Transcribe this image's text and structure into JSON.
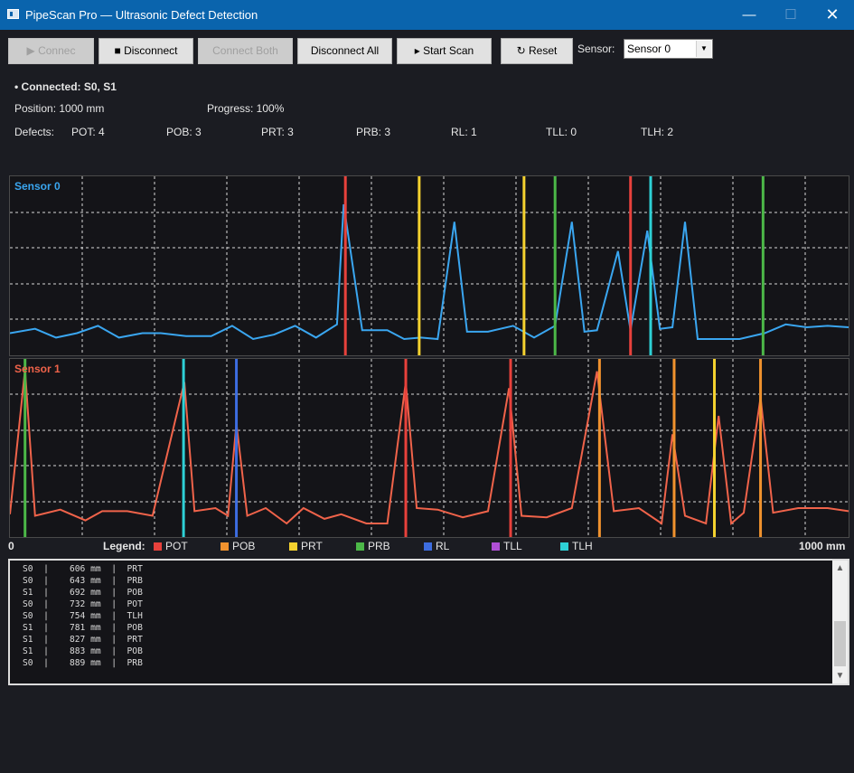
{
  "window": {
    "title": "PipeScan Pro — Ultrasonic Defect Detection",
    "min_glyph": "—",
    "max_glyph": "☐",
    "close_glyph": "✕"
  },
  "toolbar": {
    "connect_label": "▶ Connec",
    "disconnect_label": "■ Disconnect",
    "connect_both_label": "Connect Both",
    "disconnect_all_label": "Disconnect All",
    "start_scan_label": "▸ Start Scan",
    "reset_label": "↻ Reset",
    "sensor_label": "Sensor:",
    "sensor_selected": "Sensor 0",
    "sensor_arrow": "▼"
  },
  "status": {
    "connected": "• Connected: S0, S1",
    "position": "Position: 1000 mm",
    "progress": "Progress: 100%"
  },
  "defects": {
    "label": "Defects:",
    "items": [
      "POT: 4",
      "POB: 3",
      "PRT: 3",
      "PRB: 3",
      "RL: 1",
      "TLL: 0",
      "TLH: 2"
    ]
  },
  "colors": {
    "POT": "#e8413c",
    "POB": "#f0922e",
    "PRT": "#f5d22f",
    "PRB": "#4cb848",
    "RL": "#3d6de0",
    "TLL": "#b04fd6",
    "TLH": "#2ed1d6",
    "sensor0": "#3aa6f0",
    "sensor1": "#f0634a"
  },
  "sensor0": {
    "label": "Sensor 0",
    "trace": [
      [
        0,
        0.04
      ],
      [
        30,
        0.07
      ],
      [
        55,
        0.01
      ],
      [
        80,
        0.04
      ],
      [
        105,
        0.09
      ],
      [
        130,
        0.01
      ],
      [
        158,
        0.04
      ],
      [
        180,
        0.04
      ],
      [
        210,
        0.02
      ],
      [
        240,
        0.02
      ],
      [
        265,
        0.09
      ],
      [
        290,
        0.0
      ],
      [
        315,
        0.03
      ],
      [
        340,
        0.09
      ],
      [
        365,
        0.01
      ],
      [
        390,
        0.1
      ],
      [
        398,
        0.92
      ],
      [
        420,
        0.06
      ],
      [
        450,
        0.06
      ],
      [
        470,
        0.0
      ],
      [
        490,
        0.01
      ],
      [
        510,
        0.0
      ],
      [
        530,
        0.8
      ],
      [
        545,
        0.05
      ],
      [
        570,
        0.05
      ],
      [
        600,
        0.09
      ],
      [
        625,
        0.01
      ],
      [
        650,
        0.09
      ],
      [
        670,
        0.8
      ],
      [
        685,
        0.05
      ],
      [
        700,
        0.06
      ],
      [
        725,
        0.6
      ],
      [
        740,
        0.06
      ],
      [
        760,
        0.74
      ],
      [
        775,
        0.07
      ],
      [
        790,
        0.08
      ],
      [
        805,
        0.8
      ],
      [
        820,
        0.0
      ],
      [
        840,
        0.0
      ],
      [
        870,
        0.0
      ],
      [
        900,
        0.04
      ],
      [
        925,
        0.1
      ],
      [
        950,
        0.08
      ],
      [
        975,
        0.09
      ],
      [
        1000,
        0.08
      ]
    ],
    "markers": [
      [
        400,
        "POT"
      ],
      [
        488,
        "PRT"
      ],
      [
        613,
        "PRT"
      ],
      [
        650,
        "PRB"
      ],
      [
        740,
        "POT"
      ],
      [
        764,
        "TLH"
      ],
      [
        898,
        "PRB"
      ]
    ]
  },
  "sensor1": {
    "label": "Sensor 1",
    "trace": [
      [
        0,
        0.06
      ],
      [
        18,
        1.0
      ],
      [
        30,
        0.05
      ],
      [
        60,
        0.09
      ],
      [
        90,
        0.02
      ],
      [
        110,
        0.08
      ],
      [
        140,
        0.08
      ],
      [
        170,
        0.05
      ],
      [
        208,
        0.92
      ],
      [
        220,
        0.08
      ],
      [
        245,
        0.1
      ],
      [
        260,
        0.05
      ],
      [
        270,
        0.65
      ],
      [
        283,
        0.05
      ],
      [
        305,
        0.1
      ],
      [
        330,
        0.0
      ],
      [
        350,
        0.1
      ],
      [
        375,
        0.03
      ],
      [
        395,
        0.06
      ],
      [
        425,
        0.0
      ],
      [
        450,
        0.0
      ],
      [
        472,
        0.92
      ],
      [
        485,
        0.1
      ],
      [
        510,
        0.09
      ],
      [
        540,
        0.04
      ],
      [
        570,
        0.08
      ],
      [
        595,
        0.88
      ],
      [
        610,
        0.05
      ],
      [
        640,
        0.04
      ],
      [
        670,
        0.1
      ],
      [
        700,
        0.99
      ],
      [
        720,
        0.08
      ],
      [
        750,
        0.1
      ],
      [
        777,
        0.0
      ],
      [
        790,
        0.58
      ],
      [
        805,
        0.05
      ],
      [
        830,
        0.0
      ],
      [
        845,
        0.7
      ],
      [
        860,
        0.0
      ],
      [
        875,
        0.07
      ],
      [
        895,
        0.82
      ],
      [
        910,
        0.07
      ],
      [
        940,
        0.1
      ],
      [
        975,
        0.1
      ],
      [
        1000,
        0.08
      ]
    ],
    "markers": [
      [
        18,
        "PRB"
      ],
      [
        207,
        "TLH"
      ],
      [
        270,
        "RL"
      ],
      [
        472,
        "POT"
      ],
      [
        597,
        "POT"
      ],
      [
        703,
        "POB"
      ],
      [
        792,
        "POB"
      ],
      [
        840,
        "PRT"
      ],
      [
        895,
        "POB"
      ]
    ]
  },
  "axis": {
    "start": "0",
    "end": "1000 mm"
  },
  "legend": {
    "title": "Legend:",
    "items": [
      {
        "code": "POT",
        "color": "#e8413c"
      },
      {
        "code": "POB",
        "color": "#f0922e"
      },
      {
        "code": "PRT",
        "color": "#f5d22f"
      },
      {
        "code": "PRB",
        "color": "#4cb848"
      },
      {
        "code": "RL",
        "color": "#3d6de0"
      },
      {
        "code": "TLL",
        "color": "#b04fd6"
      },
      {
        "code": "TLH",
        "color": "#2ed1d6"
      }
    ]
  },
  "log": {
    "rows": [
      {
        "sensor": "S0",
        "pos": "606 mm",
        "type": "PRT"
      },
      {
        "sensor": "S0",
        "pos": "643 mm",
        "type": "PRB"
      },
      {
        "sensor": "S1",
        "pos": "692 mm",
        "type": "POB"
      },
      {
        "sensor": "S0",
        "pos": "732 mm",
        "type": "POT"
      },
      {
        "sensor": "S0",
        "pos": "754 mm",
        "type": "TLH"
      },
      {
        "sensor": "S1",
        "pos": "781 mm",
        "type": "POB"
      },
      {
        "sensor": "S1",
        "pos": "827 mm",
        "type": "PRT"
      },
      {
        "sensor": "S1",
        "pos": "883 mm",
        "type": "POB"
      },
      {
        "sensor": "S0",
        "pos": "889 mm",
        "type": "PRB"
      }
    ],
    "scroll_up": "▲",
    "scroll_down": "▼"
  }
}
